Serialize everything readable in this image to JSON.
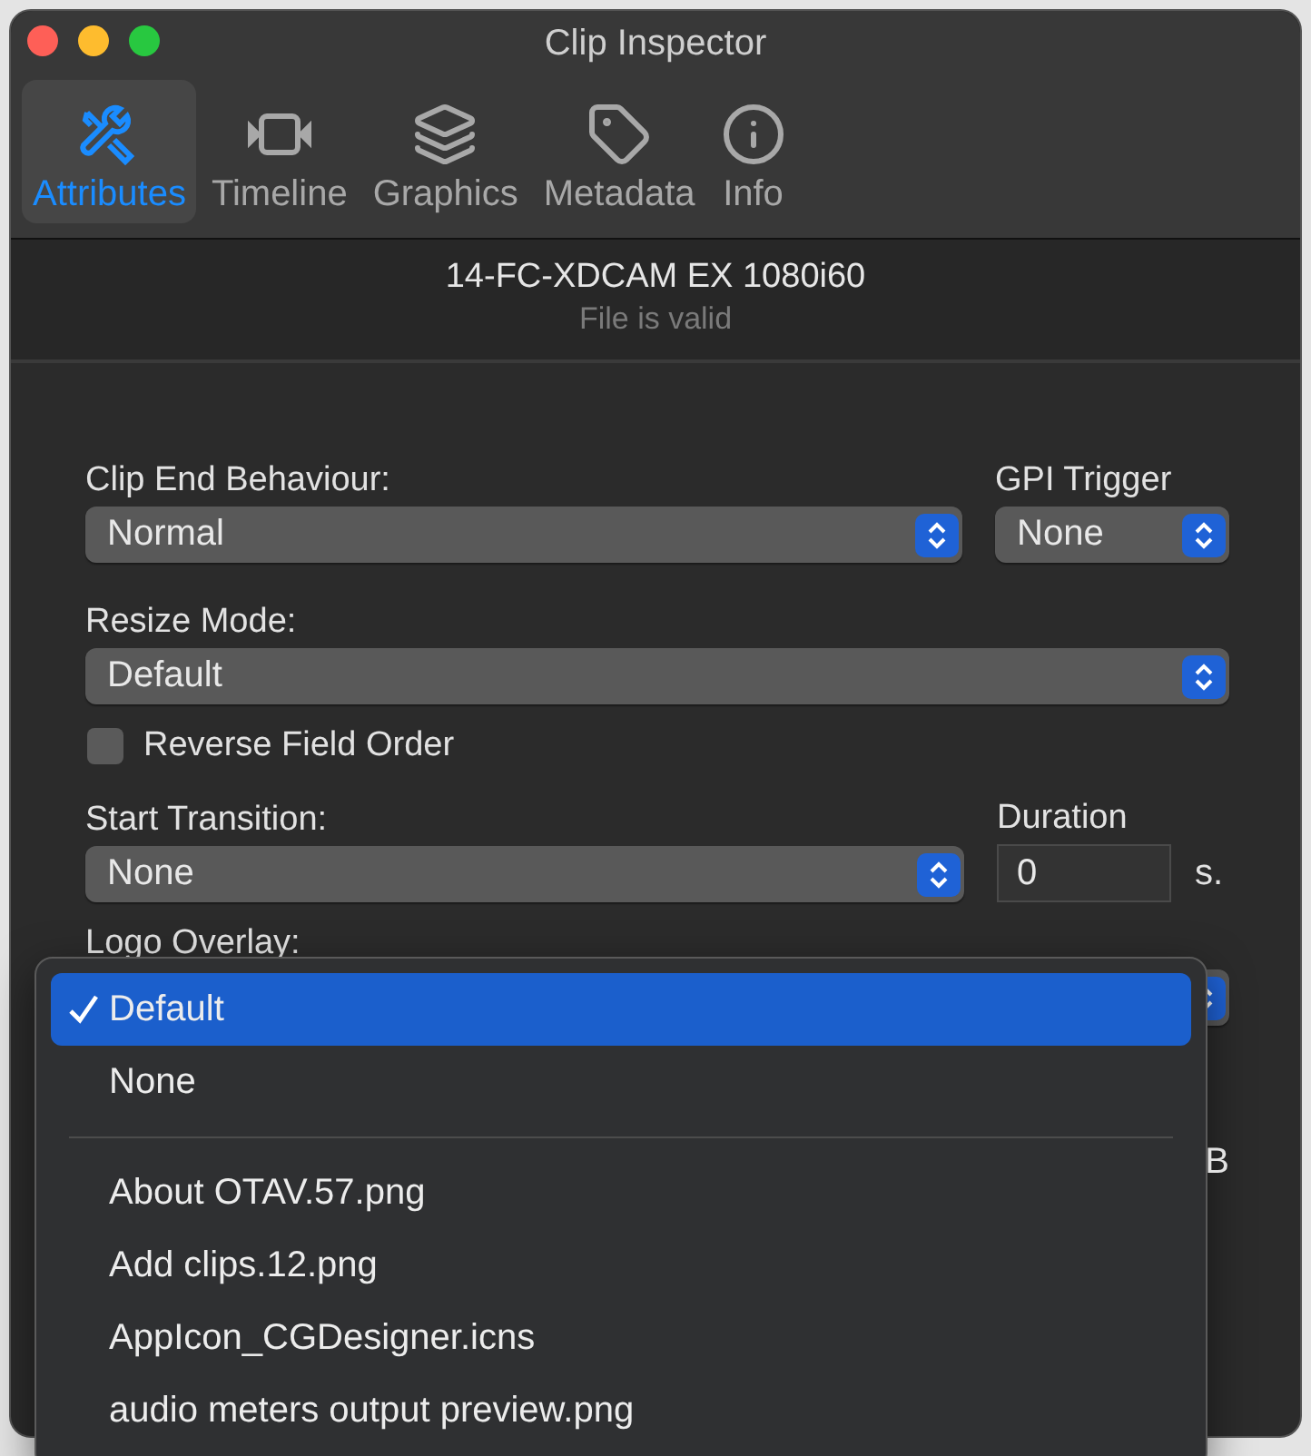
{
  "window": {
    "title": "Clip Inspector"
  },
  "tabs": [
    {
      "label": "Attributes",
      "selected": true
    },
    {
      "label": "Timeline",
      "selected": false
    },
    {
      "label": "Graphics",
      "selected": false
    },
    {
      "label": "Metadata",
      "selected": false
    },
    {
      "label": "Info",
      "selected": false
    }
  ],
  "clip": {
    "name": "14-FC-XDCAM EX 1080i60",
    "status": "File is valid"
  },
  "form": {
    "clip_end_label": "Clip End Behaviour:",
    "clip_end_value": "Normal",
    "gpi_label": "GPI Trigger",
    "gpi_value": "None",
    "resize_label": "Resize Mode:",
    "resize_value": "Default",
    "reverse_field_order": {
      "label": "Reverse Field Order",
      "checked": false
    },
    "start_transition_label": "Start Transition:",
    "start_transition_value": "None",
    "duration_label": "Duration",
    "duration_value": "0",
    "duration_unit": "s.",
    "logo_overlay_label": "Logo Overlay:",
    "partial_text": "B"
  },
  "menu": [
    {
      "kind": "item",
      "label": "Default",
      "selected": true
    },
    {
      "kind": "item",
      "label": "None",
      "selected": false
    },
    {
      "kind": "separator"
    },
    {
      "kind": "item",
      "label": "About OTAV.57.png",
      "selected": false
    },
    {
      "kind": "item",
      "label": "Add clips.12.png",
      "selected": false
    },
    {
      "kind": "item",
      "label": "AppIcon_CGDesigner.icns",
      "selected": false
    },
    {
      "kind": "item",
      "label": "audio meters output preview.png",
      "selected": false
    }
  ]
}
